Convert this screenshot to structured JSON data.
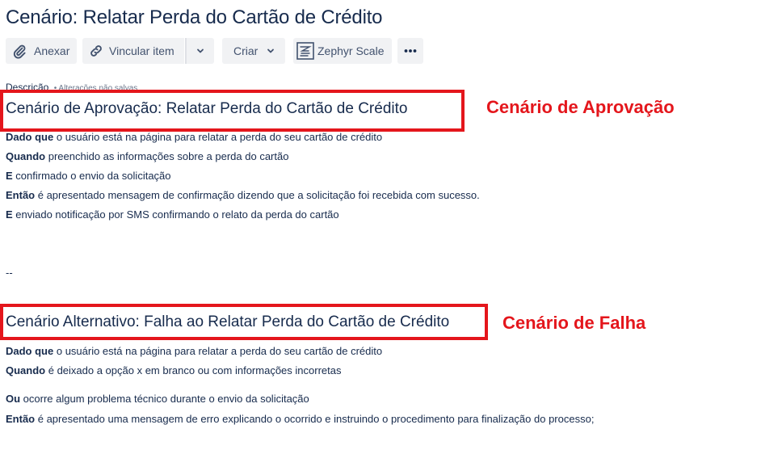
{
  "page": {
    "title": "Cenário: Relatar Perda do Cartão de Crédito"
  },
  "toolbar": {
    "attach_label": "Anexar",
    "link_label": "Vincular item",
    "create_label": "Criar",
    "zephyr_label": "Zephyr Scale"
  },
  "description": {
    "label": "Descrição",
    "unsaved_note": "• Alterações não salvas"
  },
  "scenario_approval": {
    "heading": "Cenário de Aprovação: Relatar Perda do Cartão de Crédito",
    "annotation": "Cenário de Aprovação",
    "lines": [
      {
        "keyword": "Dado que",
        "text": " o usuário está na página para relatar a perda do seu cartão de crédito"
      },
      {
        "keyword": "Quando",
        "text": " preenchido as informações sobre a perda do cartão"
      },
      {
        "keyword": "E",
        "text": " confirmado o envio da solicitação"
      },
      {
        "keyword": "Então",
        "text": " é apresentado mensagem de confirmação dizendo que a solicitação foi recebida com sucesso."
      },
      {
        "keyword": "E",
        "text": " enviado notificação por SMS confirmando o relato da perda do cartão"
      }
    ]
  },
  "separator": "--",
  "scenario_failure": {
    "heading": "Cenário Alternativo: Falha ao Relatar Perda do Cartão de Crédito",
    "annotation": "Cenário de Falha",
    "lines": [
      {
        "keyword": "Dado que",
        "text": " o usuário está na página para relatar a perda do seu cartão de crédito"
      },
      {
        "keyword": "Quando",
        "text": " é deixado a opção x em branco ou com informações incorretas"
      },
      {
        "keyword": "Ou",
        "text": " ocorre algum problema técnico durante o envio da solicitação"
      },
      {
        "keyword": "Então",
        "text": " é apresentado uma mensagem de erro explicando o ocorrido e instruindo o procedimento para finalização do processo;"
      }
    ]
  },
  "colors": {
    "highlight": "#e4161c",
    "text": "#172b4d",
    "button_bg": "#f1f2f4"
  },
  "icons": [
    "paperclip-icon",
    "link-icon",
    "chevron-down-icon",
    "zephyr-icon",
    "more-icon"
  ]
}
